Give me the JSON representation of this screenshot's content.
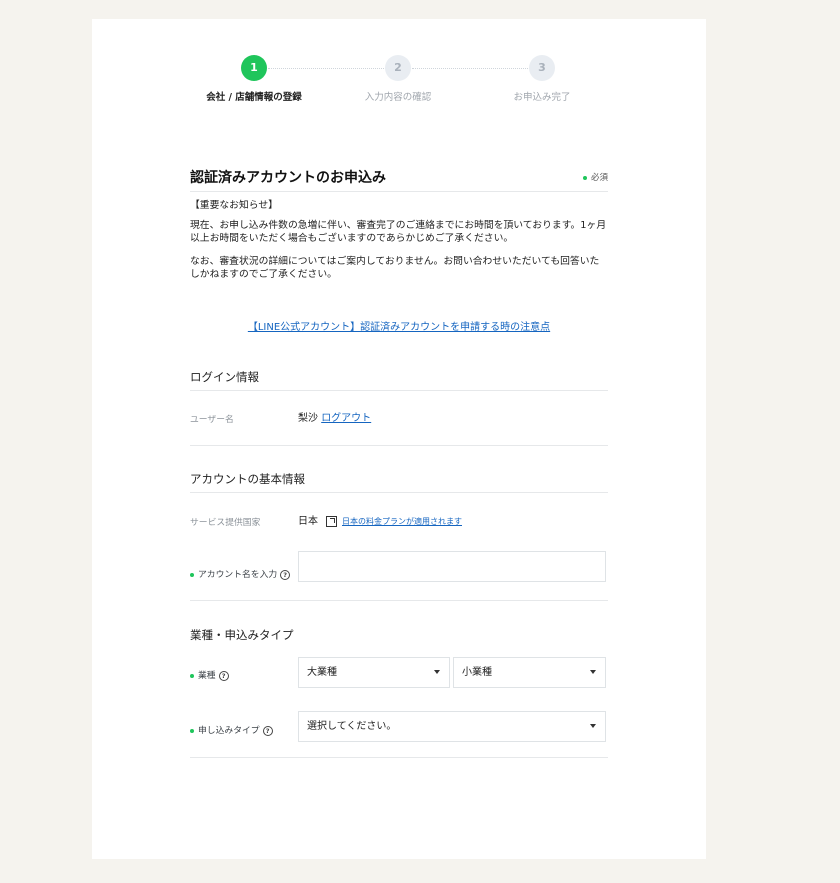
{
  "steps": [
    {
      "num": "1",
      "label": "会社 / 店舗情報の登録",
      "state": "active"
    },
    {
      "num": "2",
      "label": "入力内容の確認",
      "state": "inactive"
    },
    {
      "num": "3",
      "label": "お申込み完了",
      "state": "inactive"
    }
  ],
  "form": {
    "title": "認証済みアカウントのお申込み",
    "required_note": "必須"
  },
  "notice": {
    "heading": "【重要なお知らせ】",
    "para1": "現在、お申し込み件数の急増に伴い、審査完了のご連絡までにお時間を頂いております。1ヶ月以上お時間をいただく場合もございますのであらかじめご了承ください。",
    "para2": "なお、審査状況の詳細についてはご案内しておりません。お問い合わせいただいても回答いたしかねますのでご了承ください。"
  },
  "caution_link": "【LINE公式アカウント】認証済みアカウントを申請する時の注意点",
  "login": {
    "section_title": "ログイン情報",
    "username_label": "ユーザー名",
    "username_value": "梨沙",
    "logout_label": "ログアウト"
  },
  "basic": {
    "section_title": "アカウントの基本情報",
    "country_label": "サービス提供国家",
    "country_value": "日本",
    "plan_link": "日本の料金プランが適用されます",
    "account_name_label": "アカウント名を入力",
    "account_name_value": ""
  },
  "industry": {
    "section_title": "業種・申込みタイプ",
    "industry_label": "業種",
    "major_selected": "大業種",
    "minor_selected": "小業種",
    "apply_type_label": "申し込みタイプ",
    "apply_type_selected": "選択してください。"
  },
  "colors": {
    "accent": "#1fc55b",
    "link": "#1565c0",
    "background": "#f5f3ee"
  }
}
